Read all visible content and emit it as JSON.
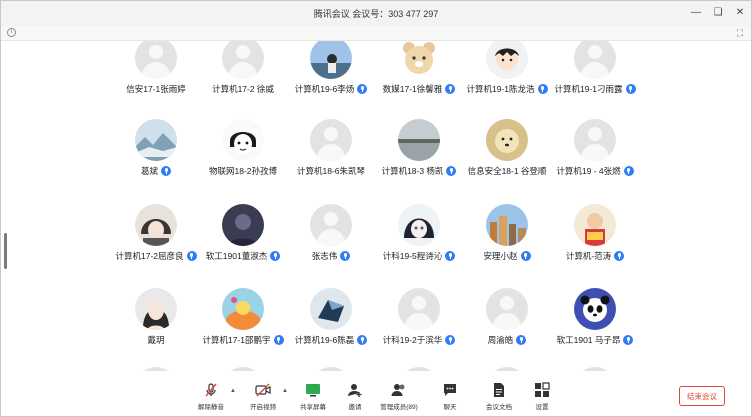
{
  "title": "腾讯会议  会议号：303 477 297",
  "participants": [
    {
      "name": "信安17-1张雨婷",
      "mic": false,
      "avatar": "default"
    },
    {
      "name": "计算机17-2 徐威",
      "mic": false,
      "avatar": "default"
    },
    {
      "name": "计算机19-6李炀",
      "mic": true,
      "avatar": "photo"
    },
    {
      "name": "数媒17-1徐馨雅",
      "mic": true,
      "avatar": "bear"
    },
    {
      "name": "计算机19-1陈龙浩",
      "mic": true,
      "avatar": "cartoon"
    },
    {
      "name": "计算机19-1刁雨露",
      "mic": true,
      "avatar": "default"
    },
    {
      "name": "葛斌",
      "mic": true,
      "avatar": "landscape"
    },
    {
      "name": "物联网18-2孙孜博",
      "mic": false,
      "avatar": "sketch"
    },
    {
      "name": "计算机18-6朱凯琴",
      "mic": false,
      "avatar": "default"
    },
    {
      "name": "计算机18-3 杨凯",
      "mic": true,
      "avatar": "lake"
    },
    {
      "name": "信息安全18-1 谷登顺",
      "mic": false,
      "avatar": "dog"
    },
    {
      "name": "计算机19 - 4张燃",
      "mic": true,
      "avatar": "default"
    },
    {
      "name": "计算机17-2屈彦良",
      "mic": true,
      "avatar": "anime"
    },
    {
      "name": "软工1901董淑杰",
      "mic": true,
      "avatar": "dark"
    },
    {
      "name": "张志伟",
      "mic": true,
      "avatar": "default"
    },
    {
      "name": "计科19-5程诗沁",
      "mic": true,
      "avatar": "anime-girl"
    },
    {
      "name": "安理小赵",
      "mic": true,
      "avatar": "city"
    },
    {
      "name": "计算机-范涛",
      "mic": true,
      "avatar": "kid"
    },
    {
      "name": "戴玥",
      "mic": false,
      "avatar": "portrait"
    },
    {
      "name": "计算机17-1邵鹏宇",
      "mic": true,
      "avatar": "colorful"
    },
    {
      "name": "计算机19-6陈磊",
      "mic": true,
      "avatar": "geometry"
    },
    {
      "name": "计科19-2于滨华",
      "mic": true,
      "avatar": "default"
    },
    {
      "name": "周渝皓",
      "mic": true,
      "avatar": "default"
    },
    {
      "name": "软工1901 马子昂",
      "mic": true,
      "avatar": "panda"
    }
  ],
  "toolbar": {
    "mute": "解除静音",
    "video": "开启视频",
    "share": "共享屏幕",
    "invite": "邀请",
    "manage": "管理成员(89)",
    "chat": "聊天",
    "docs": "会议文档",
    "settings": "设置",
    "end": "结束会议"
  },
  "colors": {
    "accent": "#2f7cf6",
    "end": "#e0453a",
    "share": "#2fa84f"
  }
}
